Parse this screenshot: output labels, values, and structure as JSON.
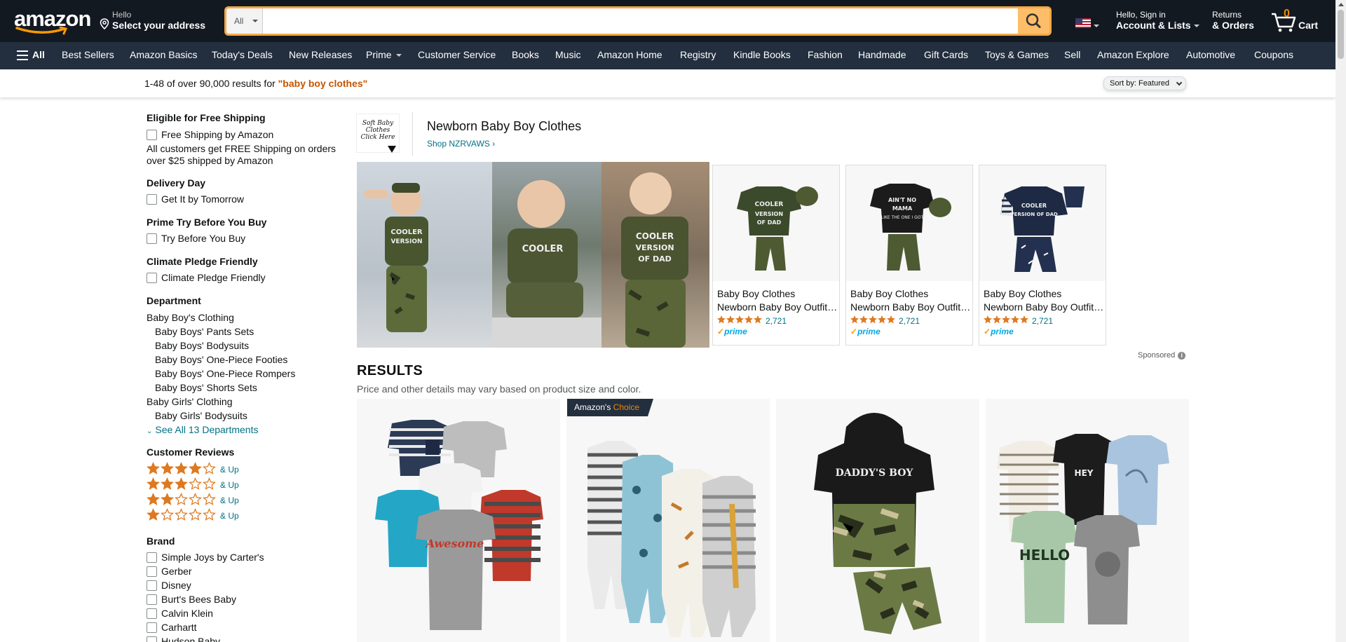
{
  "header": {
    "logo_text": "amazon",
    "deliver_line1": "Hello",
    "deliver_line2": "Select your address",
    "search_category": "All",
    "search_placeholder": "",
    "account_line1": "Hello, Sign in",
    "account_line2": "Account & Lists",
    "orders_line1": "Returns",
    "orders_line2": "& Orders",
    "cart_count": "0",
    "cart_label": "Cart"
  },
  "nav": {
    "all_label": "All",
    "items": [
      "Best Sellers",
      "Amazon Basics",
      "Today's Deals",
      "New Releases",
      "Prime",
      "Customer Service",
      "Books",
      "Music",
      "Amazon Home",
      "Registry",
      "Kindle Books",
      "Fashion",
      "Handmade",
      "Gift Cards",
      "Toys & Games",
      "Sell",
      "Amazon Explore",
      "Automotive",
      "Coupons"
    ]
  },
  "results_bar": {
    "count_text": "1-48 of over 90,000 results for ",
    "query": "\"baby boy clothes\"",
    "sort_label": "Sort by: ",
    "sort_value": "Featured"
  },
  "sidebar": {
    "free_shipping_title": "Eligible for Free Shipping",
    "free_shipping_option": "Free Shipping by Amazon",
    "free_shipping_note": "All customers get FREE Shipping on orders over $25 shipped by Amazon",
    "delivery_title": "Delivery Day",
    "delivery_option": "Get It by Tomorrow",
    "try_title": "Prime Try Before You Buy",
    "try_option": "Try Before You Buy",
    "climate_title": "Climate Pledge Friendly",
    "climate_option": "Climate Pledge Friendly",
    "department_title": "Department",
    "departments": [
      {
        "label": "Baby Boy's Clothing",
        "sub": false
      },
      {
        "label": "Baby Boys' Pants Sets",
        "sub": true
      },
      {
        "label": "Baby Boys' Bodysuits",
        "sub": true
      },
      {
        "label": "Baby Boys' One-Piece Footies",
        "sub": true
      },
      {
        "label": "Baby Boys' One-Piece Rompers",
        "sub": true
      },
      {
        "label": "Baby Boys' Shorts Sets",
        "sub": true
      },
      {
        "label": "Baby Girls' Clothing",
        "sub": false
      },
      {
        "label": "Baby Girls' Bodysuits",
        "sub": true
      }
    ],
    "see_all": "See All 13 Departments",
    "reviews_title": "Customer Reviews",
    "reviews": [
      {
        "stars": 4,
        "label": "& Up"
      },
      {
        "stars": 3,
        "label": "& Up"
      },
      {
        "stars": 2,
        "label": "& Up"
      },
      {
        "stars": 1,
        "label": "& Up"
      }
    ],
    "brand_title": "Brand",
    "brands": [
      "Simple Joys by Carter's",
      "Gerber",
      "Disney",
      "Burt's Bees Baby",
      "Calvin Klein",
      "Carhartt",
      "Hudson Baby"
    ]
  },
  "sponsored_brand": {
    "logo_text": "Soft Baby Clothes Click Here",
    "title": "Newborn Baby Boy Clothes",
    "shop_link": "Shop NZRVAWS",
    "cards": [
      {
        "title_line1": "Baby Boy Clothes",
        "title_line2": "Newborn Baby Boy Outfit Inf...",
        "rating_count": "2,721",
        "prime": "prime",
        "shirt_color": "#3c4a2c",
        "print": "COOLER VERSION OF DAD"
      },
      {
        "title_line1": "Baby Boy Clothes",
        "title_line2": "Newborn Baby Boy Outfit Inf...",
        "rating_count": "2,721",
        "prime": "prime",
        "shirt_color": "#1b1b1b",
        "print": "AIN'T NO MAMA LIKE THE ONE I GOT"
      },
      {
        "title_line1": "Baby Boy Clothes",
        "title_line2": "Newborn Baby Boy Outfit Inf...",
        "rating_count": "2,721",
        "prime": "prime",
        "shirt_color": "#1e2a44",
        "print": "COOLER VERSION OF DAD"
      }
    ],
    "sponsored_label": "Sponsored"
  },
  "results": {
    "title": "RESULTS",
    "subtitle": "Price and other details may vary based on product size and color.",
    "badge_prefix": "Amazon's",
    "badge_suffix": "Choice",
    "tile_prints": [
      "Awesome",
      "DADDY'S BOY",
      "HELLO",
      "HEY"
    ]
  },
  "colors": {
    "header_bg": "#131921",
    "nav_bg": "#232f3e",
    "accent": "#febd69",
    "query": "#c45500",
    "link": "#007185",
    "star": "#de7921"
  }
}
